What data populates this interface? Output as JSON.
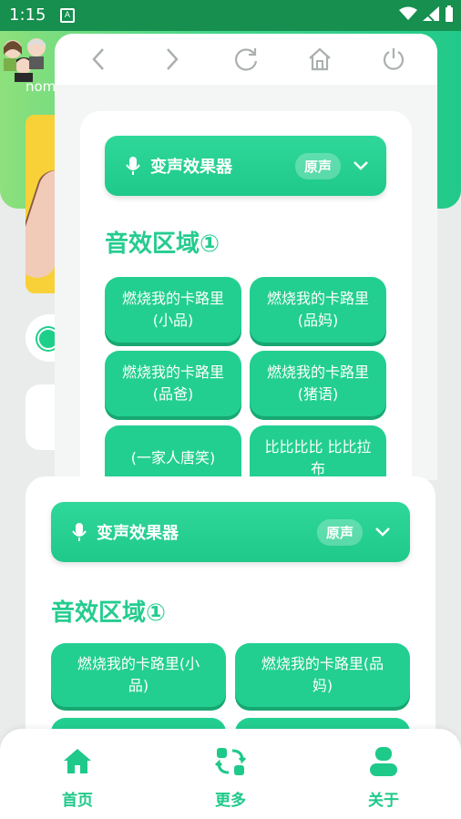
{
  "status_bar": {
    "time": "1:15",
    "app_icon_letter": "A"
  },
  "background": {
    "username": "nom"
  },
  "browser_toolbar": {
    "icons": [
      "back-icon",
      "forward-icon",
      "refresh-icon",
      "home-icon",
      "power-icon"
    ]
  },
  "floating_panel": {
    "effect_selector": {
      "title": "变声效果器",
      "current": "原声"
    },
    "section_title": "音效区域①",
    "buttons": [
      "燃烧我的卡路里\n(小品)",
      "燃烧我的卡路里\n(品妈)",
      "燃烧我的卡路里\n(品爸)",
      "燃烧我的卡路里\n(猪语)",
      "(一家人唐笑)",
      "比比比比 比比拉\n布"
    ]
  },
  "main_panel": {
    "effect_selector": {
      "title": "变声效果器",
      "current": "原声"
    },
    "section_title": "音效区域①",
    "buttons": [
      "燃烧我的卡路里(小\n品)",
      "燃烧我的卡路里(品\n妈)"
    ]
  },
  "bottom_nav": {
    "items": [
      {
        "label": "首页",
        "icon": "home-icon"
      },
      {
        "label": "更多",
        "icon": "swap-icon"
      },
      {
        "label": "关于",
        "icon": "user-icon"
      }
    ]
  },
  "colors": {
    "accent": "#22cf90",
    "accent_dark": "#17a872",
    "status_bar": "#168f4f"
  }
}
